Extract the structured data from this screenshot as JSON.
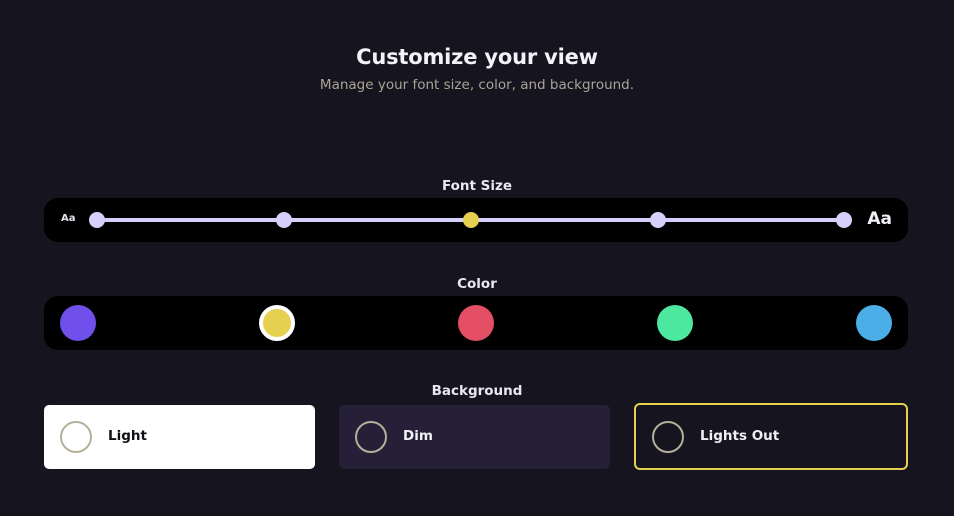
{
  "header": {
    "title": "Customize your view",
    "subtitle": "Manage your font size, color, and background."
  },
  "font_size": {
    "label": "Font Size",
    "small_icon_text": "Aa",
    "large_icon_text": "Aa",
    "steps": 5,
    "selected_index": 2,
    "track_color": "#d6cffc",
    "active_color": "#e5d14f"
  },
  "color": {
    "label": "Color",
    "swatches": [
      {
        "name": "purple",
        "hex": "#6f50ea",
        "selected": false
      },
      {
        "name": "yellow",
        "hex": "#e5d14f",
        "selected": true
      },
      {
        "name": "red",
        "hex": "#e54f66",
        "selected": false
      },
      {
        "name": "green",
        "hex": "#4de8a0",
        "selected": false
      },
      {
        "name": "blue",
        "hex": "#4caee6",
        "selected": false
      }
    ]
  },
  "background": {
    "label": "Background",
    "options": [
      {
        "label": "Light",
        "bg": "#ffffff",
        "selected": false
      },
      {
        "label": "Dim",
        "bg": "#252038",
        "selected": false
      },
      {
        "label": "Lights Out",
        "bg": "#15141f",
        "selected": true
      }
    ]
  }
}
